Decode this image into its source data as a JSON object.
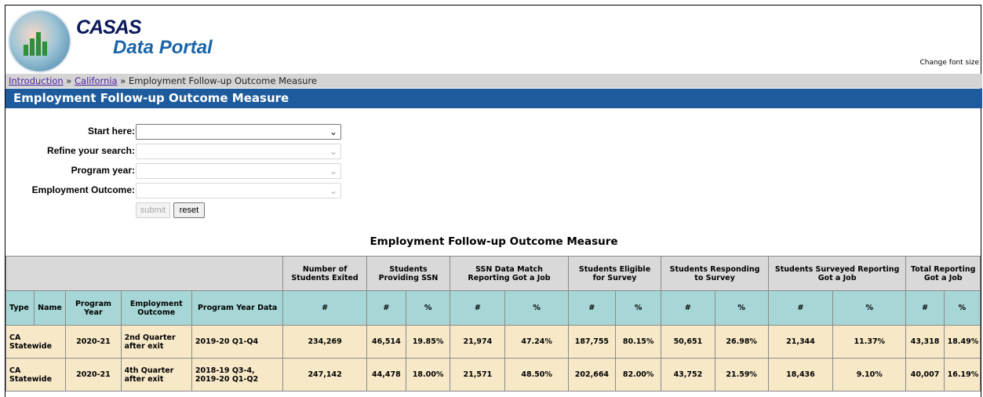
{
  "header": {
    "logo_text": "CASAS",
    "portal_title": "Data Portal",
    "font_size_link": "Change font size",
    "logo_icon": "chart-photo-icon"
  },
  "breadcrumb": {
    "items": [
      "Introduction",
      "California"
    ],
    "separator": "»",
    "current": "Employment Follow-up Outcome Measure"
  },
  "page_title": "Employment Follow-up Outcome Measure",
  "form": {
    "start_label": "Start here:",
    "refine_label": "Refine your search:",
    "program_year_label": "Program year:",
    "employment_outcome_label": "Employment Outcome:",
    "submit_label": "submit",
    "reset_label": "reset"
  },
  "table": {
    "title": "Employment Follow-up Outcome Measure",
    "group_headers": [
      "Number of Students Exited",
      "Students Providing SSN",
      "SSN Data Match Reporting Got a Job",
      "Students Eligible for Survey",
      "Students Responding to Survey",
      "Students Surveyed Reporting Got a Job",
      "Total Reporting Got a Job"
    ],
    "columns": {
      "type": "Type",
      "name": "Name",
      "program_year": "Program Year",
      "employment_outcome": "Employment Outcome",
      "program_year_data": "Program Year Data",
      "count": "#",
      "pct": "%"
    },
    "rows": [
      {
        "type": "CA Statewide",
        "program_year": "2020-21",
        "employment_outcome": "2nd Quarter after exit",
        "program_year_data": "2019-20 Q1-Q4",
        "exited": "234,269",
        "ssn_n": "46,514",
        "ssn_p": "19.85%",
        "match_n": "21,974",
        "match_p": "47.24%",
        "elig_n": "187,755",
        "elig_p": "80.15%",
        "resp_n": "50,651",
        "resp_p": "26.98%",
        "surv_n": "21,344",
        "surv_p": "11.37%",
        "total_n": "43,318",
        "total_p": "18.49%"
      },
      {
        "type": "CA Statewide",
        "program_year": "2020-21",
        "employment_outcome": "4th Quarter after exit",
        "program_year_data": "2018-19 Q3-4, 2019-20 Q1-Q2",
        "exited": "247,142",
        "ssn_n": "44,478",
        "ssn_p": "18.00%",
        "match_n": "21,571",
        "match_p": "48.50%",
        "elig_n": "202,664",
        "elig_p": "82.00%",
        "resp_n": "43,752",
        "resp_p": "21.59%",
        "surv_n": "18,436",
        "surv_p": "9.10%",
        "total_n": "40,007",
        "total_p": "16.19%"
      }
    ]
  }
}
